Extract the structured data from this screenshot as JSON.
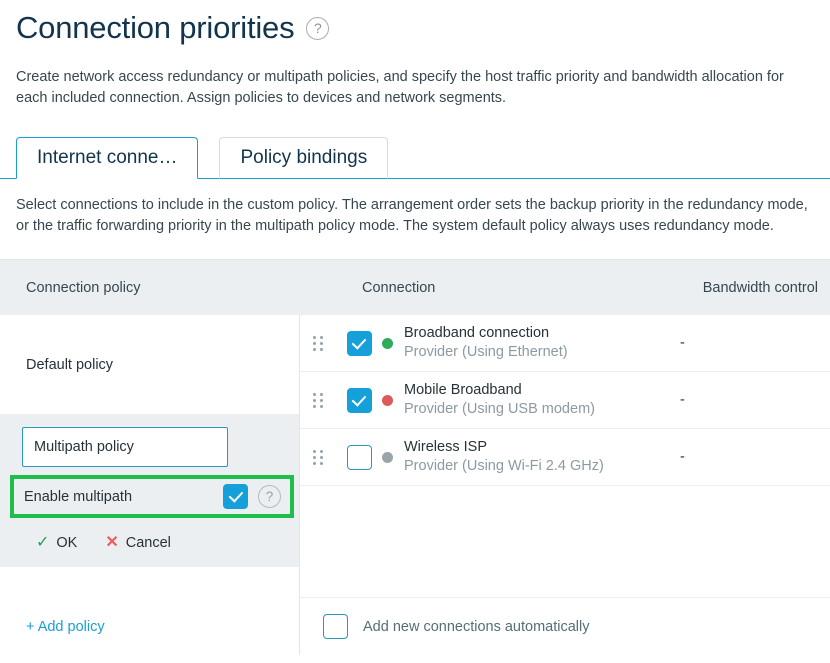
{
  "header": {
    "title": "Connection priorities",
    "help_icon": "question-mark-circle-icon",
    "description": "Create network access redundancy or multipath policies, and specify the host traffic priority and bandwidth allocation for each included connection. Assign policies to devices and network segments."
  },
  "tabs": [
    {
      "label": "Internet conne…",
      "active": true
    },
    {
      "label": "Policy bindings",
      "active": false
    }
  ],
  "section": {
    "description": "Select connections to include in the custom policy. The arrangement order sets the backup priority in the redundancy mode, or the traffic forwarding priority in the multipath policy mode. The system default policy always uses redundancy mode."
  },
  "table": {
    "headers": {
      "policy": "Connection policy",
      "connection": "Connection",
      "bandwidth": "Bandwidth control"
    },
    "policies": [
      {
        "name": "Default policy"
      }
    ],
    "connections": [
      {
        "name": "Broadband connection",
        "provider": "Provider (Using Ethernet)",
        "checked": true,
        "status_color": "#2eab5b",
        "bandwidth": "-",
        "drag_icon": "drag-handle-icon"
      },
      {
        "name": "Mobile Broadband",
        "provider": "Provider (Using USB modem)",
        "checked": true,
        "status_color": "#dd5a5a",
        "bandwidth": "-",
        "drag_icon": "drag-handle-icon"
      },
      {
        "name": "Wireless ISP",
        "provider": "Provider (Using Wi-Fi 2.4 GHz)",
        "checked": false,
        "status_color": "#9aa5ab",
        "bandwidth": "-",
        "drag_icon": "drag-handle-icon"
      }
    ],
    "auto_add": {
      "label": "Add new connections automatically",
      "checked": false
    }
  },
  "policy_form": {
    "name_value": "Multipath policy",
    "name_placeholder": "Policy name",
    "enable_label": "Enable multipath",
    "enable_checked": true,
    "enable_help_icon": "question-mark-circle-icon",
    "ok_label": "OK",
    "ok_icon": "check-icon",
    "cancel_label": "Cancel",
    "cancel_icon": "cross-icon",
    "highlight_color": "#1fbe4a"
  },
  "footer": {
    "add_policy_label": "+ Add policy"
  },
  "colors": {
    "accent_blue": "#16a0da",
    "tab_border": "#1a9ed4",
    "header_bg": "#eceff1",
    "title": "#12344d",
    "highlight_green": "#1fbe4a",
    "ok_green": "#22a157",
    "cancel_red": "#f05c5c"
  }
}
